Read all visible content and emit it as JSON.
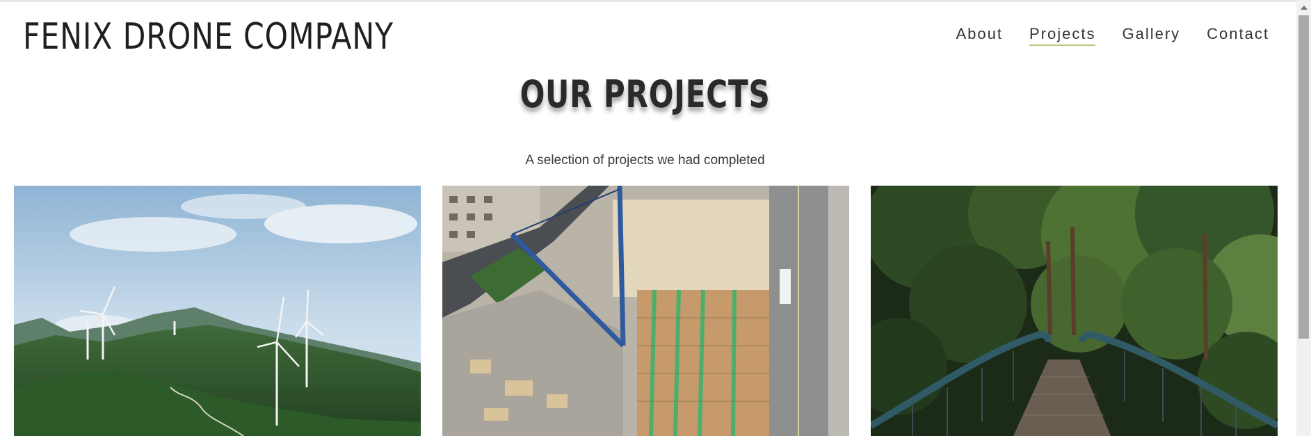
{
  "site": {
    "brand": "FENIX DRONE COMPANY"
  },
  "nav": {
    "items": [
      {
        "label": "About"
      },
      {
        "label": "Projects",
        "active": true
      },
      {
        "label": "Gallery"
      },
      {
        "label": "Contact"
      }
    ],
    "active_underline_color": "#b9c57a"
  },
  "main": {
    "title": "OUR PROJECTS",
    "subtitle": "A selection of projects we had completed",
    "projects": [
      {
        "image": "wind-turbines-on-green-hills-photo"
      },
      {
        "image": "aerial-construction-site-with-crane-photo"
      },
      {
        "image": "footbridge-into-forest-photo"
      }
    ]
  }
}
